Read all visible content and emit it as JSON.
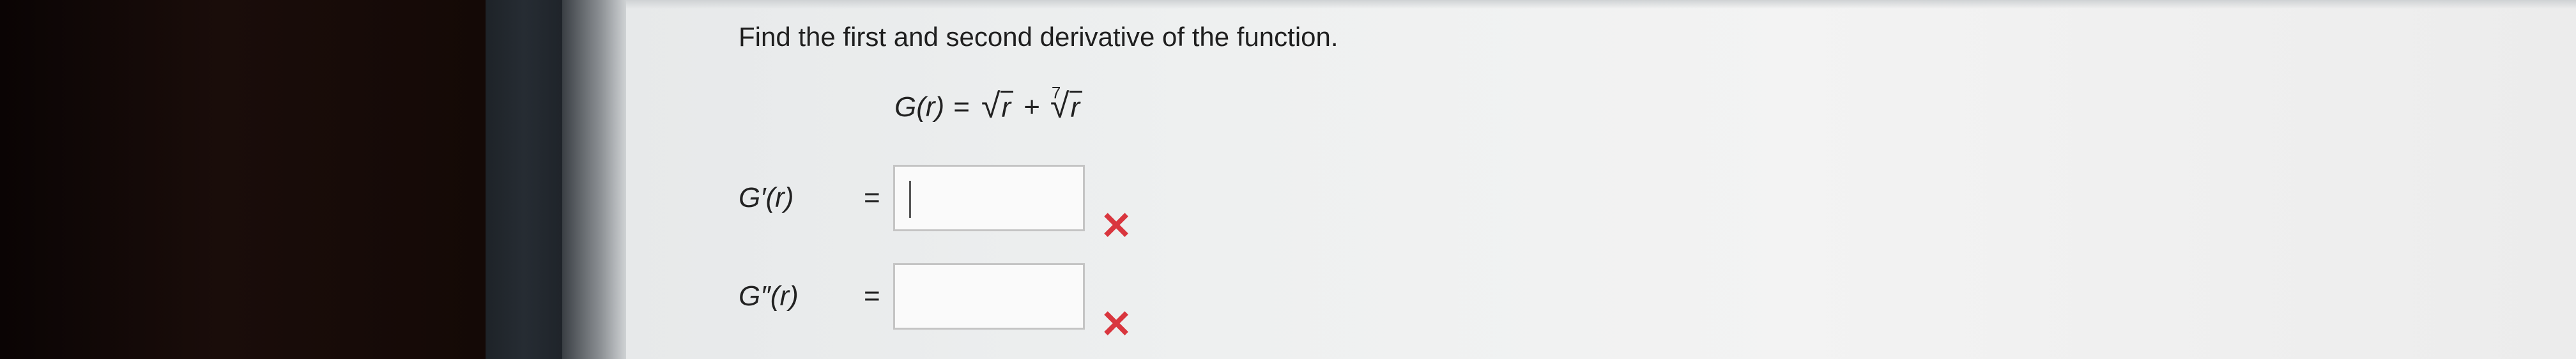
{
  "question": {
    "prompt": "Find the first and second derivative of the function."
  },
  "function": {
    "lhs": "G(r)",
    "equals": "=",
    "sqrt_radicand": "r",
    "plus": "+",
    "root_index": "7",
    "root_radicand": "r"
  },
  "answers": [
    {
      "label": "G′(r)",
      "equals": "=",
      "value": "",
      "status": "incorrect",
      "status_icon": "x-mark-icon"
    },
    {
      "label": "G″(r)",
      "equals": "=",
      "value": "",
      "status": "incorrect",
      "status_icon": "x-mark-icon"
    }
  ],
  "colors": {
    "incorrect": "#d9363e",
    "text": "#222222",
    "input_border": "#c4c4c4"
  }
}
